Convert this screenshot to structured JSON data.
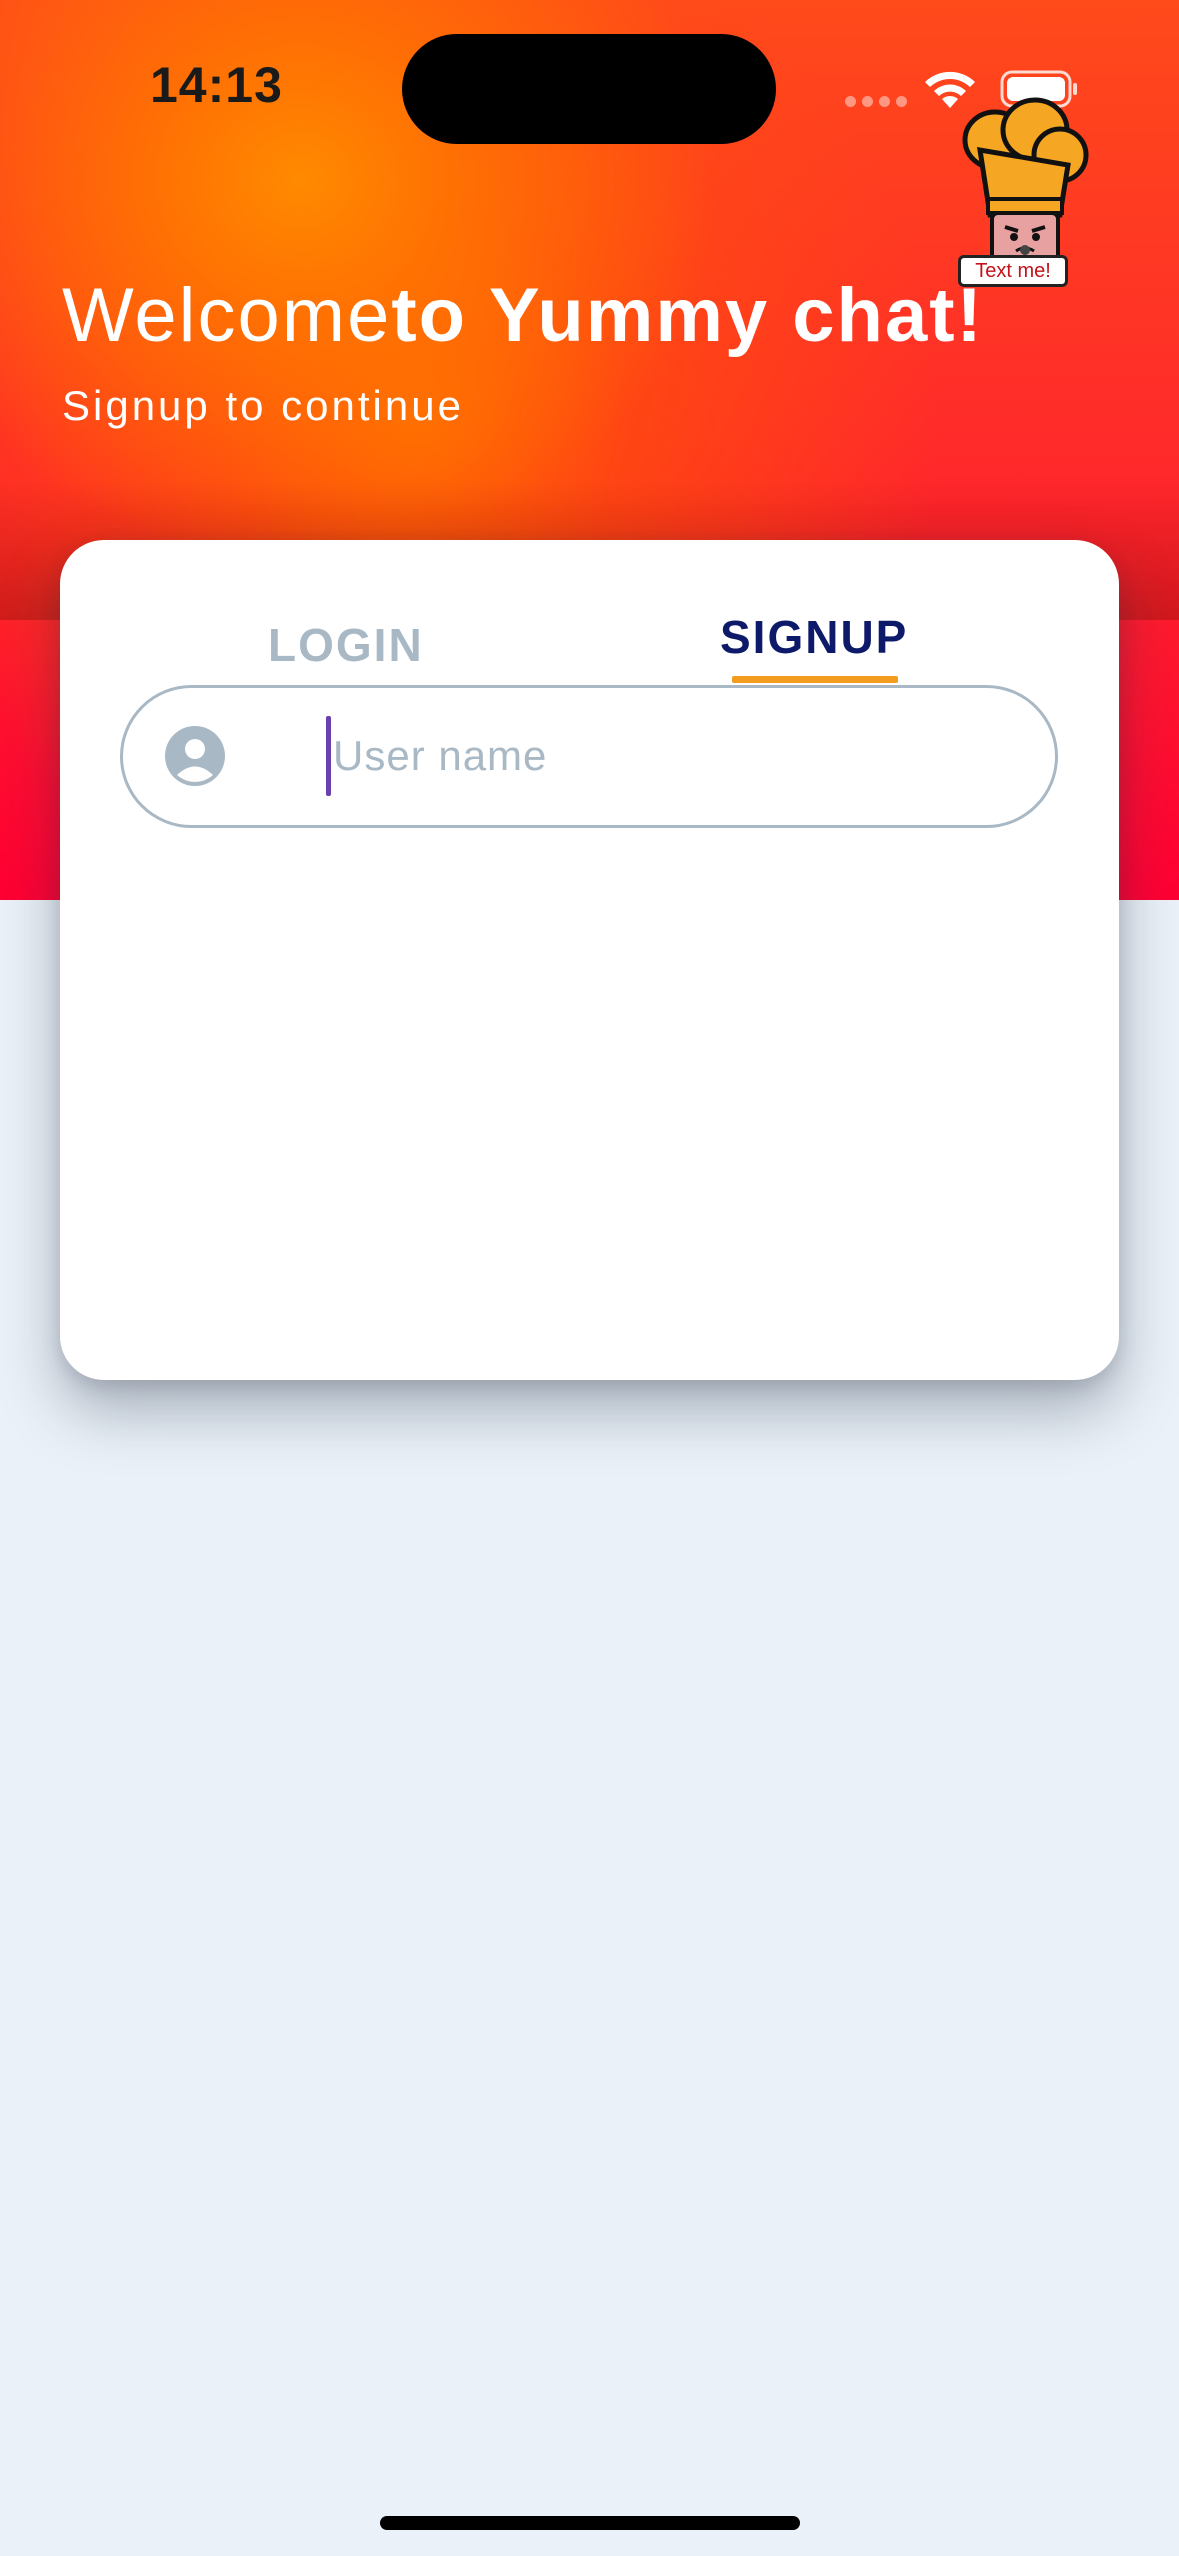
{
  "status_bar": {
    "time": "14:13"
  },
  "mascot": {
    "label": "Text me!"
  },
  "header": {
    "title_light": "Welcome",
    "title_bold": "to Yummy chat!",
    "subtitle": "Signup to continue"
  },
  "tabs": [
    {
      "label": "LOGIN",
      "active": false
    },
    {
      "label": "SIGNUP",
      "active": true
    }
  ],
  "form": {
    "username": {
      "value": "",
      "placeholder": "User name"
    }
  },
  "colors": {
    "accent_underline": "#f29d1e",
    "active_tab": "#0d1a6a",
    "inactive_tab": "#a8b8c4",
    "caret": "#6a3fb0",
    "hero_top": "#ff8a00",
    "hero_bottom": "#ff0033",
    "background": "#eaf1f8"
  },
  "icons": {
    "wifi": "wifi-icon",
    "battery": "battery-icon",
    "user": "user-circle-icon",
    "mascot": "chef-mascot-icon"
  }
}
